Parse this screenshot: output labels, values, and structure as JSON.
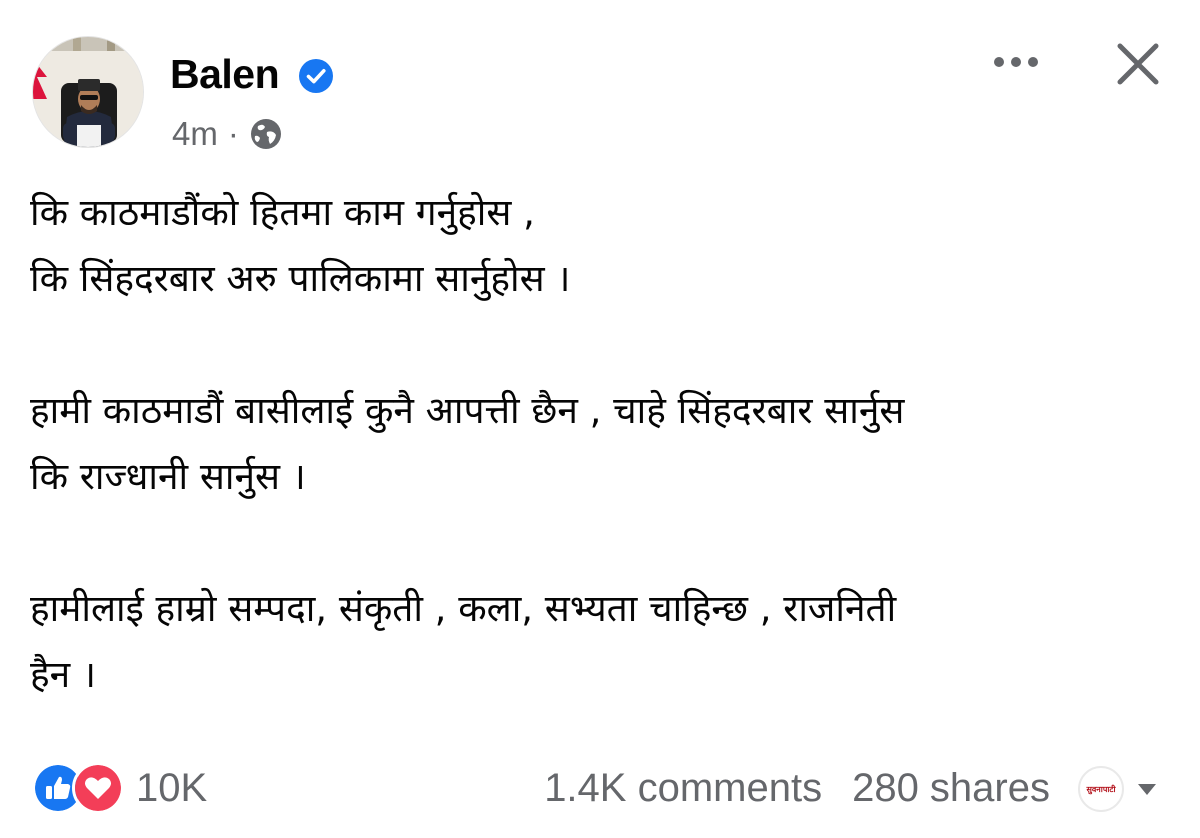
{
  "post": {
    "author": "Balen",
    "time": "4m",
    "separator": "·",
    "body": [
      [
        "कि काठमाडौंको हितमा काम गर्नुहोस ,",
        "कि सिंहदरबार अरु पालिकामा सार्नुहोस ।"
      ],
      [
        "हामी काठमाडौं बासीलाई कुनै आपत्ती छैन , चाहे सिंहदरबार सार्नुस",
        "कि राज्धानी सार्नुस  ।"
      ],
      [
        "हामीलाई हाम्रो सम्पदा, संकृती , कला, सभ्यता चाहिन्छ , राजनिती",
        "हैन ।"
      ]
    ]
  },
  "footer": {
    "reactions_count": "10K",
    "comments": "1.4K comments",
    "shares": "280 shares",
    "page_badge_text": "सुवनापाटी"
  },
  "icons": {
    "verified": "verified-badge-icon",
    "audience": "globe-icon",
    "more": "more-options-icon",
    "close": "close-icon",
    "like": "like-icon",
    "love": "love-icon",
    "dropdown": "dropdown-caret-icon"
  },
  "colors": {
    "facebook_blue": "#1877f2",
    "love_red": "#f33e58",
    "secondary_text": "#65676b",
    "primary_text": "#050505"
  }
}
